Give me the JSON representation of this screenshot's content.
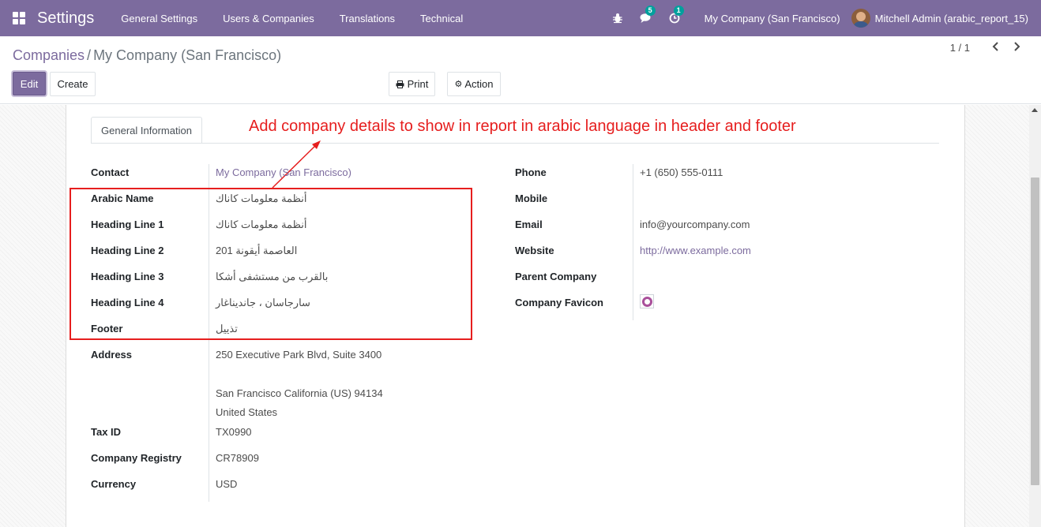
{
  "navbar": {
    "app_title": "Settings",
    "menu": [
      "General Settings",
      "Users & Companies",
      "Translations",
      "Technical"
    ],
    "icons": {
      "debug": "bug-icon",
      "messages": "chat-icon",
      "activities": "clock-icon"
    },
    "messages_badge": "5",
    "activities_badge": "1",
    "company": "My Company (San Francisco)",
    "user": "Mitchell Admin (arabic_report_15)"
  },
  "breadcrumb": {
    "parent": "Companies",
    "separator": "/",
    "current": "My Company (San Francisco)"
  },
  "toolbar": {
    "edit": "Edit",
    "create": "Create",
    "print": "Print",
    "action": "Action"
  },
  "pager": {
    "value": "1 / 1"
  },
  "tab": {
    "label": "General Information"
  },
  "annotation": "Add company details to show in report in arabic language in header and footer",
  "left_fields": [
    {
      "label": "Contact",
      "value": "My Company (San Francisco)"
    },
    {
      "label": "Arabic Name",
      "value": "أنظمة معلومات كاناك"
    },
    {
      "label": "Heading Line 1",
      "value": "أنظمة معلومات كاناك"
    },
    {
      "label": "Heading Line 2",
      "value": "العاصمة أيقونة 201"
    },
    {
      "label": "Heading Line 3",
      "value": "بالقرب من مستشفى أشكا"
    },
    {
      "label": "Heading Line 4",
      "value": "سارجاسان ، جانديناغار"
    },
    {
      "label": "Footer",
      "value": "تذييل"
    },
    {
      "label": "Address",
      "value": "250 Executive Park Blvd, Suite 3400"
    },
    {
      "label": "Tax ID",
      "value": "TX0990"
    },
    {
      "label": "Company Registry",
      "value": "CR78909"
    },
    {
      "label": "Currency",
      "value": "USD"
    }
  ],
  "address_lines": [
    "San Francisco  California (US)  94134",
    "United States"
  ],
  "right_fields": [
    {
      "label": "Phone",
      "value": "+1 (650) 555-0111"
    },
    {
      "label": "Mobile",
      "value": ""
    },
    {
      "label": "Email",
      "value": "info@yourcompany.com"
    },
    {
      "label": "Website",
      "value": "http://www.example.com"
    },
    {
      "label": "Parent Company",
      "value": ""
    },
    {
      "label": "Company Favicon",
      "value": ""
    }
  ],
  "colors": {
    "navbar": "#7c6b9e",
    "accent": "#7c6b9e",
    "annotation": "#e61e1e",
    "badge": "#00a09d"
  }
}
